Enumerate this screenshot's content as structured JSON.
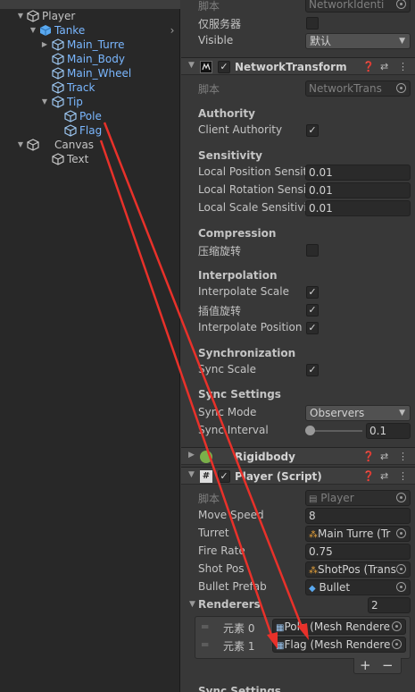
{
  "hierarchy": {
    "items": [
      {
        "label": "Player",
        "level": 0
      },
      {
        "label": "Tanke",
        "level": 1
      },
      {
        "label": "Main_Turre",
        "level": 2
      },
      {
        "label": "Main_Body",
        "level": 2
      },
      {
        "label": "Main_Wheel",
        "level": 2
      },
      {
        "label": "Track",
        "level": 2
      },
      {
        "label": "Tip",
        "level": 2
      },
      {
        "label": "Pole",
        "level": 3
      },
      {
        "label": "Flag",
        "level": 3
      },
      {
        "label": "Canvas",
        "level": 1
      },
      {
        "label": "Text",
        "level": 2
      }
    ]
  },
  "network_identity": {
    "script_label": "脚本",
    "script_value": "NetworkIdenti",
    "server_only_label": "仅服务器",
    "visible_label": "Visible",
    "visible_value": "默认"
  },
  "network_transform": {
    "title": "NetworkTransform",
    "script_label": "脚本",
    "script_value": "NetworkTrans",
    "authority_header": "Authority",
    "client_authority_label": "Client Authority",
    "sensitivity_header": "Sensitivity",
    "pos_sens_label": "Local Position Sensit",
    "pos_sens_value": "0.01",
    "rot_sens_label": "Local Rotation Sensit",
    "rot_sens_value": "0.01",
    "scale_sens_label": "Local Scale Sensitivit",
    "scale_sens_value": "0.01",
    "compression_header": "Compression",
    "compress_rot_label": "压缩旋转",
    "interpolation_header": "Interpolation",
    "interp_scale_label": "Interpolate Scale",
    "interp_rot_label": "插值旋转",
    "interp_pos_label": "Interpolate Position",
    "synchronization_header": "Synchronization",
    "sync_scale_label": "Sync Scale",
    "sync_settings_header": "Sync Settings",
    "sync_mode_label": "Sync Mode",
    "sync_mode_value": "Observers",
    "sync_interval_label": "Sync Interval",
    "sync_interval_value": "0.1",
    "sync_interval_fraction": 0.05
  },
  "rigidbody": {
    "title": "Rigidbody"
  },
  "player_script": {
    "title": "Player (Script)",
    "script_label": "脚本",
    "script_value": "Player",
    "move_speed_label": "Move Speed",
    "move_speed_value": "8",
    "turret_label": "Turret",
    "turret_value": "Main Turre (Tr",
    "fire_rate_label": "Fire Rate",
    "fire_rate_value": "0.75",
    "shot_pos_label": "Shot Pos",
    "shot_pos_value": "ShotPos (Trans",
    "bullet_prefab_label": "Bullet Prefab",
    "bullet_prefab_value": "Bullet",
    "renderers_label": "Renderers",
    "renderers_count": "2",
    "renderers": [
      {
        "label": "元素 0",
        "value": "Pole (Mesh Rendere"
      },
      {
        "label": "元素 1",
        "value": "Flag (Mesh Rendere"
      }
    ],
    "add_label": "+",
    "remove_label": "−",
    "footer_header": "Sync Settings"
  },
  "colors": {
    "accent_arrow": "#e8312a",
    "selected_blue": "#7ab7ff",
    "field_bg": "#2a2a2a"
  }
}
